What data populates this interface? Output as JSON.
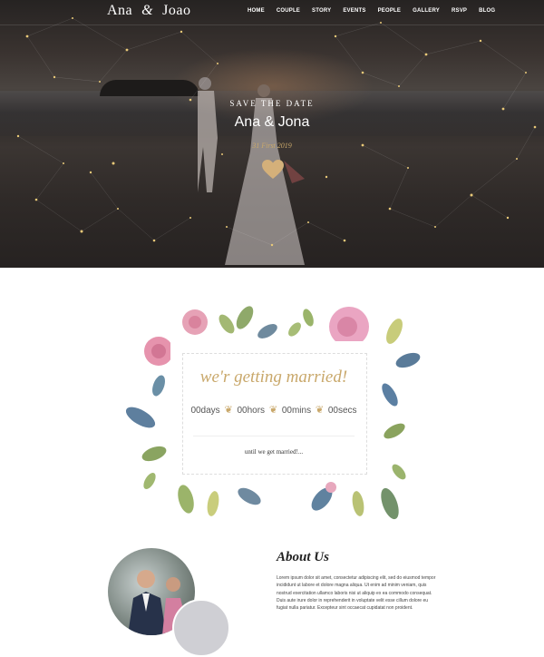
{
  "nav": {
    "logo_left": "Ana",
    "logo_amp": "&",
    "logo_right": "Joao",
    "items": [
      "HOME",
      "COUPLE",
      "STORY",
      "EVENTS",
      "PEOPLE",
      "GALLERY",
      "RSVP",
      "BLOG"
    ]
  },
  "hero": {
    "kicker": "SAVE THE DATE",
    "names": "Ana & Jona",
    "date": "31 First 2019",
    "heart_icon": "heart-icon"
  },
  "countdown": {
    "heading": "we'r getting married!",
    "days": "00days",
    "hours": "00hors",
    "mins": "00mins",
    "secs": "00secs",
    "subtext": "until we get married!..."
  },
  "about": {
    "title": "About Us",
    "text": "Lorem ipsum dolor sit amet, consectetur adipiscing elit, sed do eiusmod tempor incididunt ut labore et dolore magna aliqua. Ut enim ad minim veniam, quis nostrud exercitation ullamco laboris nisi ut aliquip ex ea commodo consequat. Duis aute irure dolor in reprehenderit in voluptate velit esse cillum dolore eu fugiat nulla pariatur. Excepteur sint occaecat cupidatat non proident."
  },
  "colors": {
    "accent": "#c9a86b",
    "hero_dark": "#2d2a29"
  }
}
